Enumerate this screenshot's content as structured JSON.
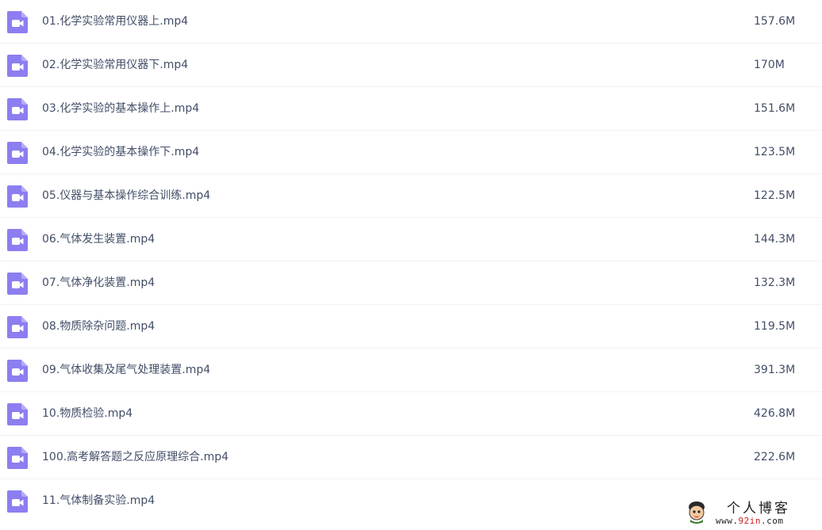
{
  "file_list": {
    "icon": "video-file-icon",
    "icon_color": "#8c7ef0",
    "items": [
      {
        "name": "01.化学实验常用仪器上.mp4",
        "size": "157.6M"
      },
      {
        "name": "02.化学实验常用仪器下.mp4",
        "size": "170M"
      },
      {
        "name": "03.化学实验的基本操作上.mp4",
        "size": "151.6M"
      },
      {
        "name": "04.化学实验的基本操作下.mp4",
        "size": "123.5M"
      },
      {
        "name": "05.仪器与基本操作综合训练.mp4",
        "size": "122.5M"
      },
      {
        "name": "06.气体发生装置.mp4",
        "size": "144.3M"
      },
      {
        "name": "07.气体净化装置.mp4",
        "size": "132.3M"
      },
      {
        "name": "08.物质除杂问题.mp4",
        "size": "119.5M"
      },
      {
        "name": "09.气体收集及尾气处理装置.mp4",
        "size": "391.3M"
      },
      {
        "name": "10.物质检验.mp4",
        "size": "426.8M"
      },
      {
        "name": "100.高考解答题之反应原理综合.mp4",
        "size": "222.6M"
      },
      {
        "name": "11.气体制备实验.mp4",
        "size": ""
      }
    ]
  },
  "watermark": {
    "title": "个人博客",
    "url_prefix": "www.",
    "url_accent": "92in",
    "url_suffix": ".com",
    "accent_color": "#d0201c"
  }
}
